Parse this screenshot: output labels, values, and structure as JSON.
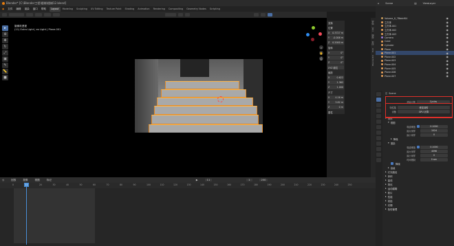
{
  "window": {
    "title": "Blender* [C:\\Blender工程\\楼梯\\楼梯12.blend]"
  },
  "menu": [
    "文件",
    "编辑",
    "渲染",
    "窗口",
    "帮助"
  ],
  "workspaces": [
    "Layout",
    "Modeling",
    "Sculpting",
    "UV Editing",
    "Texture Paint",
    "Shading",
    "Animation",
    "Rendering",
    "Compositing",
    "Geometry Nodes",
    "Scripting"
  ],
  "active_workspace": "Layout",
  "viewport": {
    "camera_label": "摄像机透视",
    "object_label": "(11) Extra Light | ex Light | Plane.001"
  },
  "npanel": {
    "title": "变换",
    "location_label": "位置",
    "loc": [
      "0.3727 m",
      "-0.006 m",
      "0.2000 m"
    ],
    "rotation_label": "旋转",
    "rot": [
      "0°",
      "0°",
      "0°"
    ],
    "xyz_label": "XYZ 欧拉",
    "scale_label": "缩放",
    "scale": [
      "0.622",
      "1.362",
      "1.000"
    ],
    "dim_label": "尺寸",
    "dim": [
      "4.16 m",
      "3.82 m",
      "0 m"
    ],
    "props_label": "属性"
  },
  "side_tabs": [
    "物品",
    "工具",
    "视图",
    "创建",
    "Edit",
    "BlenderKit"
  ],
  "timeline": {
    "menus": [
      "回放",
      "抠像",
      "视图",
      "标记"
    ],
    "current_frame": "11",
    "start": "1",
    "end": "250",
    "ticks": [
      "0",
      "10",
      "20",
      "30",
      "40",
      "50",
      "60",
      "70",
      "80",
      "90",
      "100",
      "110",
      "120",
      "130",
      "140",
      "150",
      "160",
      "170",
      "180",
      "190",
      "200",
      "210",
      "220",
      "230",
      "240",
      "250"
    ]
  },
  "outliner": {
    "scene": "Scene",
    "view_layer": "ViewLayer",
    "items": [
      {
        "name": "Volume_0_7Bbdcf04",
        "color": "#c79a5a"
      },
      {
        "name": "立方体",
        "color": "#e8a15a"
      },
      {
        "name": "立方体.001",
        "color": "#e8a15a"
      },
      {
        "name": "立方体.002",
        "color": "#e8a15a"
      },
      {
        "name": "立方体.003",
        "color": "#e8a15a"
      },
      {
        "name": "Camera",
        "color": "#9b7bd3"
      },
      {
        "name": "Cube",
        "color": "#e8a15a"
      },
      {
        "name": "Cylinder",
        "color": "#e8a15a"
      },
      {
        "name": "Plane",
        "color": "#e8a15a"
      },
      {
        "name": "Plane.001",
        "color": "#e8a15a",
        "selected": true
      },
      {
        "name": "Plane.002",
        "color": "#e8a15a"
      },
      {
        "name": "Plane.003",
        "color": "#e8a15a"
      },
      {
        "name": "Plane.004",
        "color": "#e8a15a"
      },
      {
        "name": "Plane.005",
        "color": "#e8a15a"
      },
      {
        "name": "Plane.006",
        "color": "#e8a15a"
      },
      {
        "name": "Plane.007",
        "color": "#e8a15a"
      }
    ]
  },
  "properties": {
    "scene_label": "Scene",
    "engine_label": "渲染引擎",
    "engine_value": "Cycles",
    "feature_label": "特性集",
    "feature_value": "受支持的",
    "device_label": "设备",
    "device_value": "GPU 计算",
    "sections": [
      "采样",
      "视图",
      "降噪",
      "渲染",
      "降噪",
      "高级",
      "灯光路径",
      "体积",
      "曲线",
      "简化",
      "运动模糊",
      "胶片",
      "性能",
      "烘焙",
      "光栅",
      "色彩管理"
    ],
    "rows": [
      {
        "label": "噪波阈值",
        "value": "0.1000"
      },
      {
        "label": "最大采样",
        "value": "1024"
      },
      {
        "label": "最小采样",
        "value": "0"
      },
      {
        "label": "噪波阈值",
        "value": "0.1000"
      },
      {
        "label": "最大采样",
        "value": "4096"
      },
      {
        "label": "最小采样",
        "value": "0"
      },
      {
        "label": "时间限制",
        "value": "0 sec"
      }
    ]
  }
}
